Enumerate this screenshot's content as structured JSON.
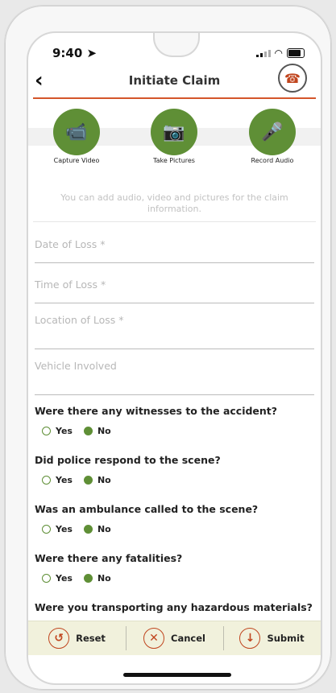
{
  "status": {
    "time": "9:40 ➤"
  },
  "header": {
    "title": "Initiate Claim"
  },
  "media": [
    {
      "label": "Capture Video",
      "icon": "video-camera-icon",
      "glyph": "📹"
    },
    {
      "label": "Take Pictures",
      "icon": "camera-icon",
      "glyph": "📷"
    },
    {
      "label": "Record Audio",
      "icon": "microphone-icon",
      "glyph": "🎤"
    }
  ],
  "helper_text": "You can add audio, video and pictures for the claim information.",
  "fields": [
    {
      "label": "Date of Loss *"
    },
    {
      "label": "Time of Loss *"
    },
    {
      "label": "Location of Loss *"
    },
    {
      "label": "Vehicle Involved"
    }
  ],
  "questions": [
    {
      "text": "Were there any witnesses to the accident?",
      "yes": "Yes",
      "no": "No",
      "selected": "No"
    },
    {
      "text": "Did police respond to the scene?",
      "yes": "Yes",
      "no": "No",
      "selected": "No"
    },
    {
      "text": "Was an ambulance called to the scene?",
      "yes": "Yes",
      "no": "No",
      "selected": "No"
    },
    {
      "text": "Were there any fatalities?",
      "yes": "Yes",
      "no": "No",
      "selected": "No"
    },
    {
      "text": "Were you transporting any hazardous materials?"
    }
  ],
  "actions": {
    "reset": "Reset",
    "cancel": "Cancel",
    "submit": "Submit"
  },
  "colors": {
    "accent": "#5f8f36",
    "alert": "#c0451e"
  }
}
